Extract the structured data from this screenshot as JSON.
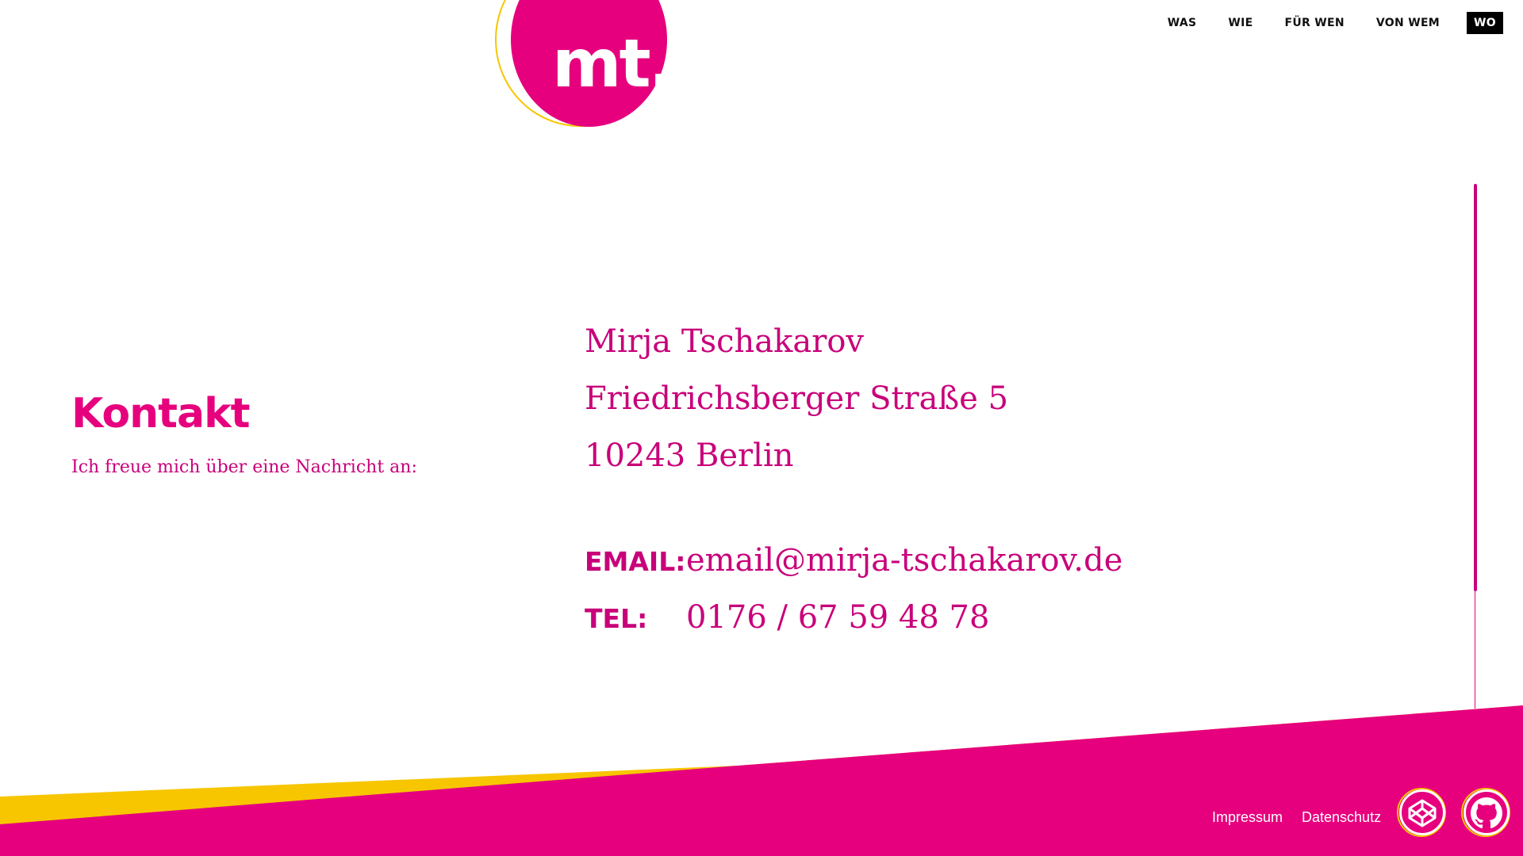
{
  "logo": {
    "text": "mt."
  },
  "nav": {
    "items": [
      {
        "label": "WAS"
      },
      {
        "label": "WIE"
      },
      {
        "label": "FÜR WEN"
      },
      {
        "label": "VON WEM"
      },
      {
        "label": "WO",
        "active": true
      }
    ]
  },
  "section": {
    "title": "Kontakt",
    "subtitle": "Ich freue mich über eine Nachricht an:"
  },
  "address": {
    "name": "Mirja Tschakarov",
    "street": "Friedrichsberger Straße 5",
    "city": "10243 Berlin"
  },
  "contact": {
    "email_label": "EMAIL:",
    "email": "email@mirja-tschakarov.de",
    "tel_label": "TEL:",
    "tel": "0176 / 67 59 48 78"
  },
  "footer": {
    "impressum": "Impressum",
    "datenschutz": "Datenschutz",
    "social": [
      {
        "icon": "codepen-icon"
      },
      {
        "icon": "github-icon"
      }
    ]
  },
  "colors": {
    "accent": "#e6007e",
    "accent_text": "#c8007a",
    "yellow": "#f7c600",
    "nav_active_bg": "#000000"
  }
}
